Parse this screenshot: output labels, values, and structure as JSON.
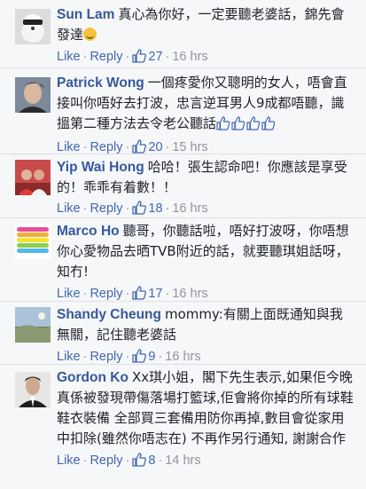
{
  "comments": [
    {
      "name": "Sun Lam",
      "text": "真心為你好，一定要聽老婆話，錦先會發達",
      "emoji": "smile-emoji",
      "like_label": "Like",
      "reply_label": "Reply",
      "likes": "27",
      "time": "16 hrs"
    },
    {
      "name": "Patrick Wong",
      "text": "一個疼愛你又聰明的女人，唔會直接叫你唔好去打波，忠言逆耳男人9成都唔聽，識搵第二種方法去令老公聽話",
      "emoji": "thumbs-up-emoji x4",
      "like_label": "Like",
      "reply_label": "Reply",
      "likes": "20",
      "time": "15 hrs"
    },
    {
      "name": "Yip Wai Hong",
      "text": "哈哈！張生認命吧！你應該是享受的！乖乖有着數！！",
      "like_label": "Like",
      "reply_label": "Reply",
      "likes": "18",
      "time": "16 hrs"
    },
    {
      "name": "Marco Ho",
      "text": "聽哥，你聽話啦，唔好打波呀，你唔想你心愛物品去晒TVB附近的話，就要聽琪姐話呀，知冇!",
      "like_label": "Like",
      "reply_label": "Reply",
      "likes": "17",
      "time": "16 hrs"
    },
    {
      "name": "Shandy Cheung",
      "text": "mommy:有關上面既通知與我無關，記住聽老婆話",
      "like_label": "Like",
      "reply_label": "Reply",
      "likes": "9",
      "time": "16 hrs"
    },
    {
      "name": "Gordon Ko",
      "text": "Xx琪小姐，閣下先生表示,如果佢今晚真係被發現帶傷落場打籃球,佢會將你掉的所有球鞋 鞋衣裝備 全部買三套備用防你再掉,數目會從家用中扣除(雖然你唔志在) 不再作另行通知, 謝謝合作",
      "like_label": "Like",
      "reply_label": "Reply",
      "likes": "8",
      "time": "14 hrs"
    }
  ],
  "colors": {
    "name": "#365899",
    "link": "#4267b2",
    "meta": "#90949c",
    "text": "#1d2129",
    "background": "#f6f7f9"
  }
}
